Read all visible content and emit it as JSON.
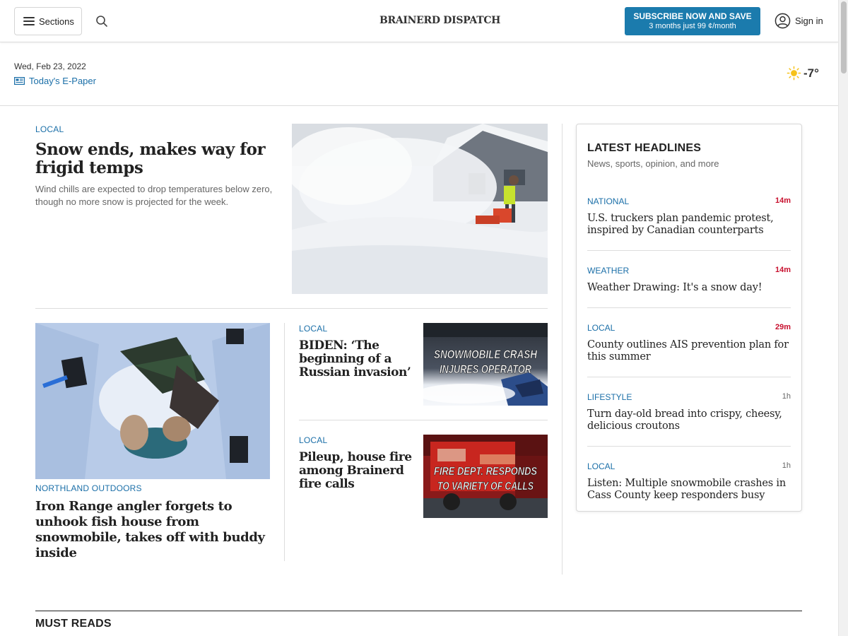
{
  "header": {
    "sections_label": "Sections",
    "logo_text": "BRAINERD DISPATCH",
    "subscribe": {
      "main": "SUBSCRIBE NOW AND SAVE",
      "sub": "3 months just 99 ¢/month"
    },
    "signin_label": "Sign in"
  },
  "datebar": {
    "date": "Wed, Feb 23, 2022",
    "epaper": "Today's E-Paper",
    "temperature": "-7°",
    "weather_icon": "sun-icon"
  },
  "lead": {
    "kicker": "LOCAL",
    "title": "Snow ends, makes way for frigid temps",
    "description": "Wind chills are expected to drop temperatures below zero, though no more snow is projected for the week.",
    "image": "snowblower-photo"
  },
  "story2": {
    "kicker": "NORTHLAND OUTDOORS",
    "title": "Iron Range angler forgets to unhook fish house from snowmobile, takes off with buddy inside",
    "image": "ice-fishing-house-photo"
  },
  "story3": {
    "kicker": "LOCAL",
    "title": "BIDEN: ‘The beginning of a Russian invasion’",
    "image_text_1": "SNOWMOBILE CRASH",
    "image_text_2": "INJURES OPERATOR"
  },
  "story4": {
    "kicker": "LOCAL",
    "title": "Pileup, house fire among Brainerd fire calls",
    "image_text_1": "FIRE DEPT. RESPONDS",
    "image_text_2": "TO VARIETY OF CALLS"
  },
  "latest": {
    "title": "LATEST HEADLINES",
    "subtitle": "News, sports, opinion, and more",
    "items": [
      {
        "kicker": "NATIONAL",
        "time": "14m",
        "headline": "U.S. truckers plan pandemic protest, inspired by Canadian counterparts"
      },
      {
        "kicker": "WEATHER",
        "time": "14m",
        "headline": "Weather Drawing: It's a snow day!"
      },
      {
        "kicker": "LOCAL",
        "time": "29m",
        "headline": "County outlines AIS prevention plan for this summer"
      },
      {
        "kicker": "LIFESTYLE",
        "time": "1h",
        "headline": "Turn day-old bread into crispy, cheesy, delicious croutons"
      },
      {
        "kicker": "LOCAL",
        "time": "1h",
        "headline": "Listen: Multiple snowmobile crashes in Cass County keep responders busy"
      }
    ]
  },
  "must_reads": {
    "title": "MUST READS"
  },
  "colors": {
    "accent": "#1b7bad",
    "link": "#1b6fa8",
    "time_recent": "#c8102e"
  }
}
